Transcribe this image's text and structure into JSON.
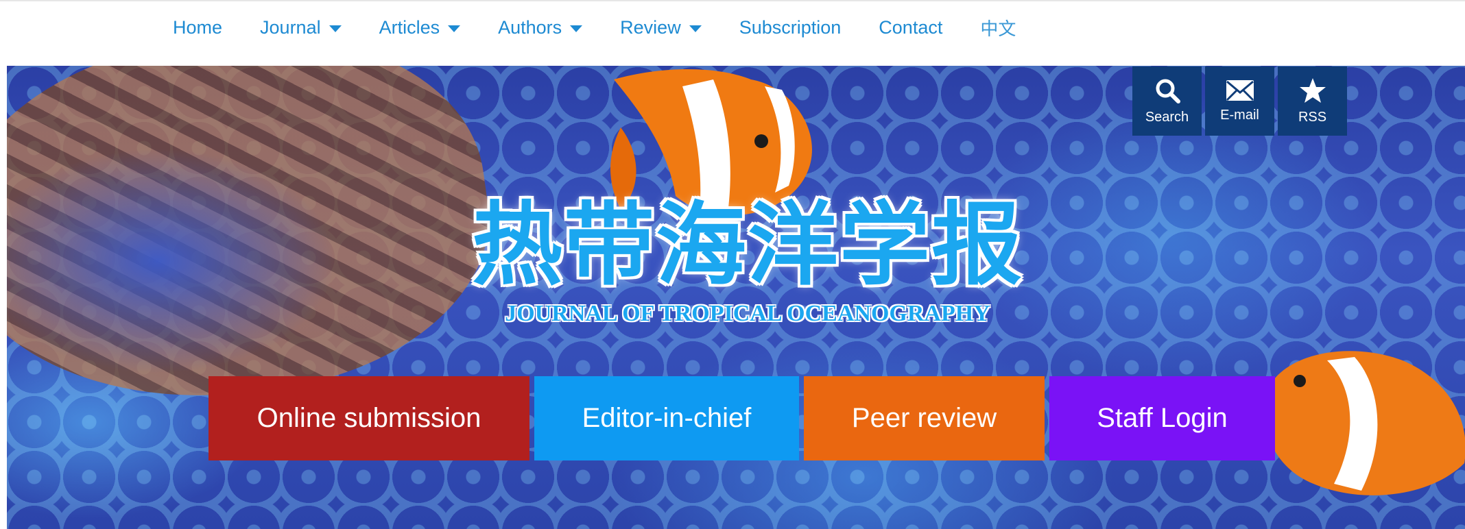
{
  "nav": {
    "items": [
      {
        "label": "Home",
        "dropdown": false
      },
      {
        "label": "Journal",
        "dropdown": true
      },
      {
        "label": "Articles",
        "dropdown": true
      },
      {
        "label": "Authors",
        "dropdown": true
      },
      {
        "label": "Review",
        "dropdown": true
      },
      {
        "label": "Subscription",
        "dropdown": false
      },
      {
        "label": "Contact",
        "dropdown": false
      },
      {
        "label": "中文",
        "dropdown": false
      }
    ]
  },
  "banner": {
    "title_cn": "热带海洋学报",
    "title_en": "JOURNAL OF TROPICAL OCEANOGRAPHY"
  },
  "tools": {
    "search_label": "Search",
    "email_label": "E-mail",
    "rss_label": "RSS",
    "search_icon": "search-icon",
    "email_icon": "envelope-icon",
    "rss_icon": "star-icon"
  },
  "actions": {
    "online_submission": "Online submission",
    "editor_in_chief": "Editor-in-chief",
    "peer_review": "Peer review",
    "staff_login": "Staff Login"
  },
  "colors": {
    "nav_link": "#1d8ad2",
    "tool_bg": "#0f3c78",
    "submission": "#b2201e",
    "editor": "#0e9af2",
    "peer": "#ea6710",
    "staff": "#7a12f6"
  }
}
